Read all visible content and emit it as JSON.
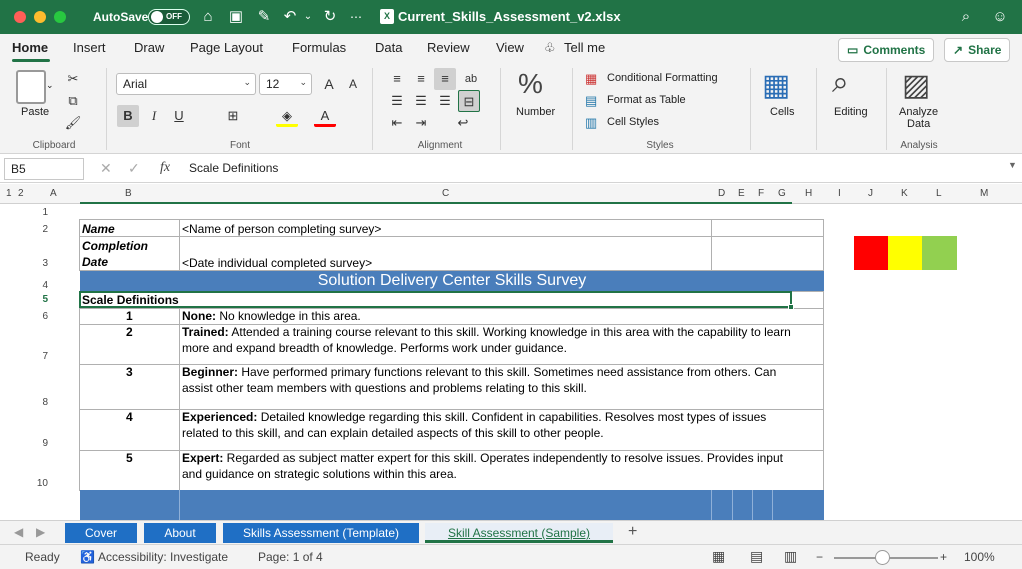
{
  "titlebar": {
    "autosave_label": "AutoSave",
    "autosave_state": "OFF",
    "file_name": "Current_Skills_Assessment_v2.xlsx"
  },
  "ribbon_tabs": [
    "Home",
    "Insert",
    "Draw",
    "Page Layout",
    "Formulas",
    "Data",
    "Review",
    "View",
    "Tell me"
  ],
  "buttons": {
    "comments": "Comments",
    "share": "Share"
  },
  "ribbon": {
    "clipboard": {
      "paste": "Paste",
      "group": "Clipboard"
    },
    "font": {
      "name": "Arial",
      "size": "12",
      "group": "Font",
      "bold": "B",
      "italic": "I",
      "underline": "U"
    },
    "alignment": {
      "group": "Alignment"
    },
    "number": {
      "label": "Number"
    },
    "styles": {
      "conditional": "Conditional Formatting",
      "table": "Format as Table",
      "cell_styles": "Cell Styles",
      "group": "Styles"
    },
    "cells": {
      "label": "Cells"
    },
    "editing": {
      "label": "Editing"
    },
    "analysis": {
      "line1": "Analyze",
      "line2": "Data",
      "group": "Analysis"
    }
  },
  "formula_bar": {
    "name_box": "B5",
    "fx": "fx",
    "content": "Scale Definitions"
  },
  "column_headers": [
    "A",
    "B",
    "C",
    "D",
    "E",
    "F",
    "G",
    "H",
    "I",
    "J",
    "K",
    "L",
    "M"
  ],
  "row_headers": [
    "1",
    "2",
    "3",
    "4",
    "5",
    "6",
    "7",
    "8",
    "9",
    "10"
  ],
  "outline_levels": [
    "1",
    "2"
  ],
  "sheet": {
    "name_label": "Name",
    "name_value": "<Name of person completing survey>",
    "completion_label_1": "Completion",
    "completion_label_2": "Date",
    "completion_value": "<Date individual completed survey>",
    "banner": "Solution Delivery Center Skills Survey",
    "scale_title": "Scale Definitions",
    "scales": [
      {
        "level": "1",
        "term": "None:",
        "text1": " No knowledge in this area.",
        "text2": ""
      },
      {
        "level": "2",
        "term": "Trained:",
        "text1": " Attended a training course relevant to this skill.  Working knowledge in this area with the capability to learn",
        "text2": "more and expand breadth of knowledge. Performs work under guidance."
      },
      {
        "level": "3",
        "term": "Beginner:",
        "text1": " Have performed primary functions relevant to this skill.  Sometimes need assistance from others.  Can",
        "text2": "assist other team members with questions and problems relating to this skill."
      },
      {
        "level": "4",
        "term": "Experienced:",
        "text1": "  Detailed knowledge regarding this skill.  Confident in capabilities.  Resolves most types of issues",
        "text2": "related to this skill, and can explain detailed aspects of this skill to other people."
      },
      {
        "level": "5",
        "term": "Expert:",
        "text1": " Regarded as subject matter expert for this skill.  Operates independently to resolve issues.  Provides input",
        "text2": "and guidance on strategic solutions within this area."
      }
    ],
    "swatch_colors": [
      "#ff0000",
      "#ffff00",
      "#92d050"
    ]
  },
  "sheet_tabs": [
    "Cover",
    "About",
    "Skills Assessment (Template)",
    "Skill Assessment (Sample)"
  ],
  "status": {
    "ready": "Ready",
    "accessibility": "Accessibility: Investigate",
    "page": "Page: 1 of 4",
    "zoom": "100%"
  },
  "colors": {
    "excel_green": "#217346",
    "banner_blue": "#4a7ebb",
    "tab_blue": "#1f6fc5"
  }
}
